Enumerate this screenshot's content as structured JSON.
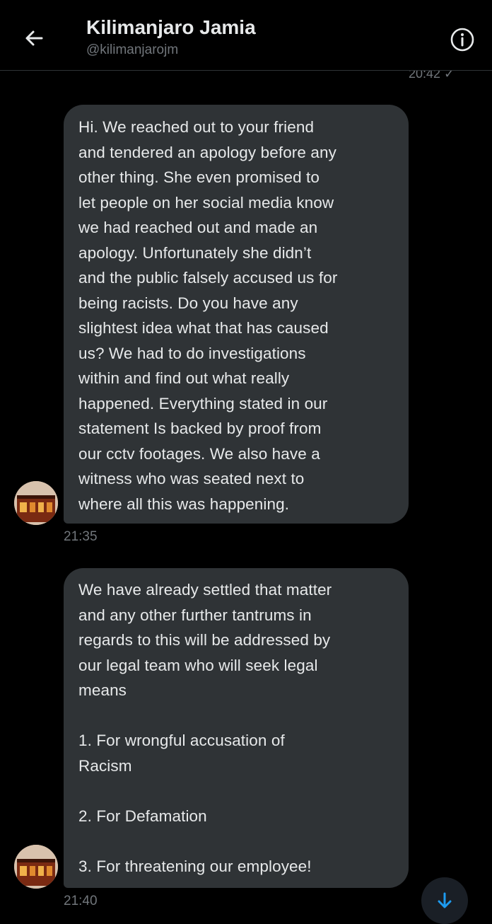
{
  "header": {
    "title": "Kilimanjaro Jamia",
    "handle": "@kilimanjarojm"
  },
  "previous_message_time": "20:42 ✓",
  "messages": [
    {
      "text": "Hi. We reached out to your friend\nand tendered an apology before any\nother thing. She even promised to\nlet people on her social media know\nwe had reached out and made an\napology. Unfortunately she didn’t\nand the public falsely accused us for\nbeing racists. Do you have any\nslightest idea what that has caused\nus? We had to do investigations\nwithin and find out what really\nhappened. Everything stated in our\nstatement Is backed by proof from\nour cctv footages. We also have a\nwitness who was seated next to\nwhere all this was happening.",
      "time": "21:35"
    },
    {
      "text": "We have already settled that matter\nand any other further tantrums in\nregards to this will be addressed by\nour legal team who will seek legal\nmeans\n\n1. For wrongful accusation of\nRacism\n\n2. For Defamation\n\n3. For threatening our employee!",
      "time": "21:40"
    }
  ],
  "icons": {
    "back": "arrow-left-icon",
    "info": "info-icon",
    "scroll": "arrow-down-icon"
  },
  "colors": {
    "background": "#000000",
    "bubble": "#2f3336",
    "text": "#e7e9ea",
    "muted": "#71767b",
    "accent": "#1d9bf0"
  }
}
